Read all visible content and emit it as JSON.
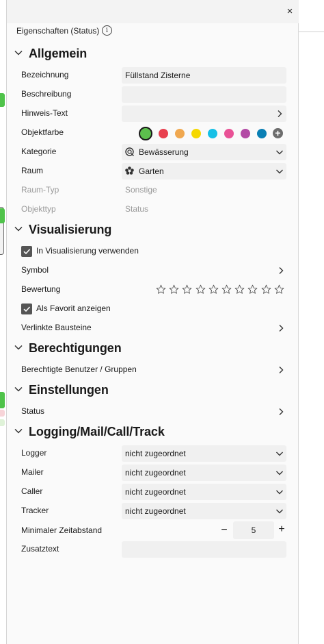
{
  "panel": {
    "title": "Eigenschaften (Status)",
    "close_symbol": "×"
  },
  "sections": {
    "allgemein": "Allgemein",
    "visualisierung": "Visualisierung",
    "berechtigungen": "Berechtigungen",
    "einstellungen": "Einstellungen",
    "logging": "Logging/Mail/Call/Track"
  },
  "allgemein": {
    "bezeichnung_label": "Bezeichnung",
    "bezeichnung_value": "Füllstand Zisterne",
    "beschreibung_label": "Beschreibung",
    "beschreibung_value": "",
    "hinweis_label": "Hinweis-Text",
    "objektfarbe_label": "Objektfarbe",
    "colors": [
      "#5cbf4d",
      "#e8404f",
      "#f0a850",
      "#f5d800",
      "#17c0e6",
      "#e95296",
      "#b34aa5",
      "#0a7fb4"
    ],
    "selected_color": "#5cbf4d",
    "kategorie_label": "Kategorie",
    "kategorie_value": "Bewässerung",
    "raum_label": "Raum",
    "raum_value": "Garten",
    "raumtyp_label": "Raum-Typ",
    "raumtyp_value": "Sonstige",
    "objekttyp_label": "Objekttyp",
    "objekttyp_value": "Status"
  },
  "visualisierung": {
    "in_visualisierung_label": "In Visualisierung verwenden",
    "in_visualisierung_checked": true,
    "symbol_label": "Symbol",
    "bewertung_label": "Bewertung",
    "rating": 0,
    "rating_max": 10,
    "favorit_label": "Als Favorit anzeigen",
    "favorit_checked": true,
    "verlinkte_label": "Verlinkte Bausteine"
  },
  "berechtigungen": {
    "benutzer_label": "Berechtigte Benutzer / Gruppen"
  },
  "einstellungen": {
    "status_label": "Status"
  },
  "logging": {
    "logger_label": "Logger",
    "logger_value": "nicht zugeordnet",
    "mailer_label": "Mailer",
    "mailer_value": "nicht zugeordnet",
    "caller_label": "Caller",
    "caller_value": "nicht zugeordnet",
    "tracker_label": "Tracker",
    "tracker_value": "nicht zugeordnet",
    "zeitabstand_label": "Minimaler Zeitabstand",
    "zeitabstand_value": "5",
    "minus_symbol": "−",
    "plus_symbol": "+",
    "zusatztext_label": "Zusatztext",
    "zusatztext_value": ""
  },
  "colors": {
    "background_tab_green": "#4fc34a",
    "background_tab_pink": "#f7d4d8",
    "background_tab_light": "#dff2d8"
  }
}
